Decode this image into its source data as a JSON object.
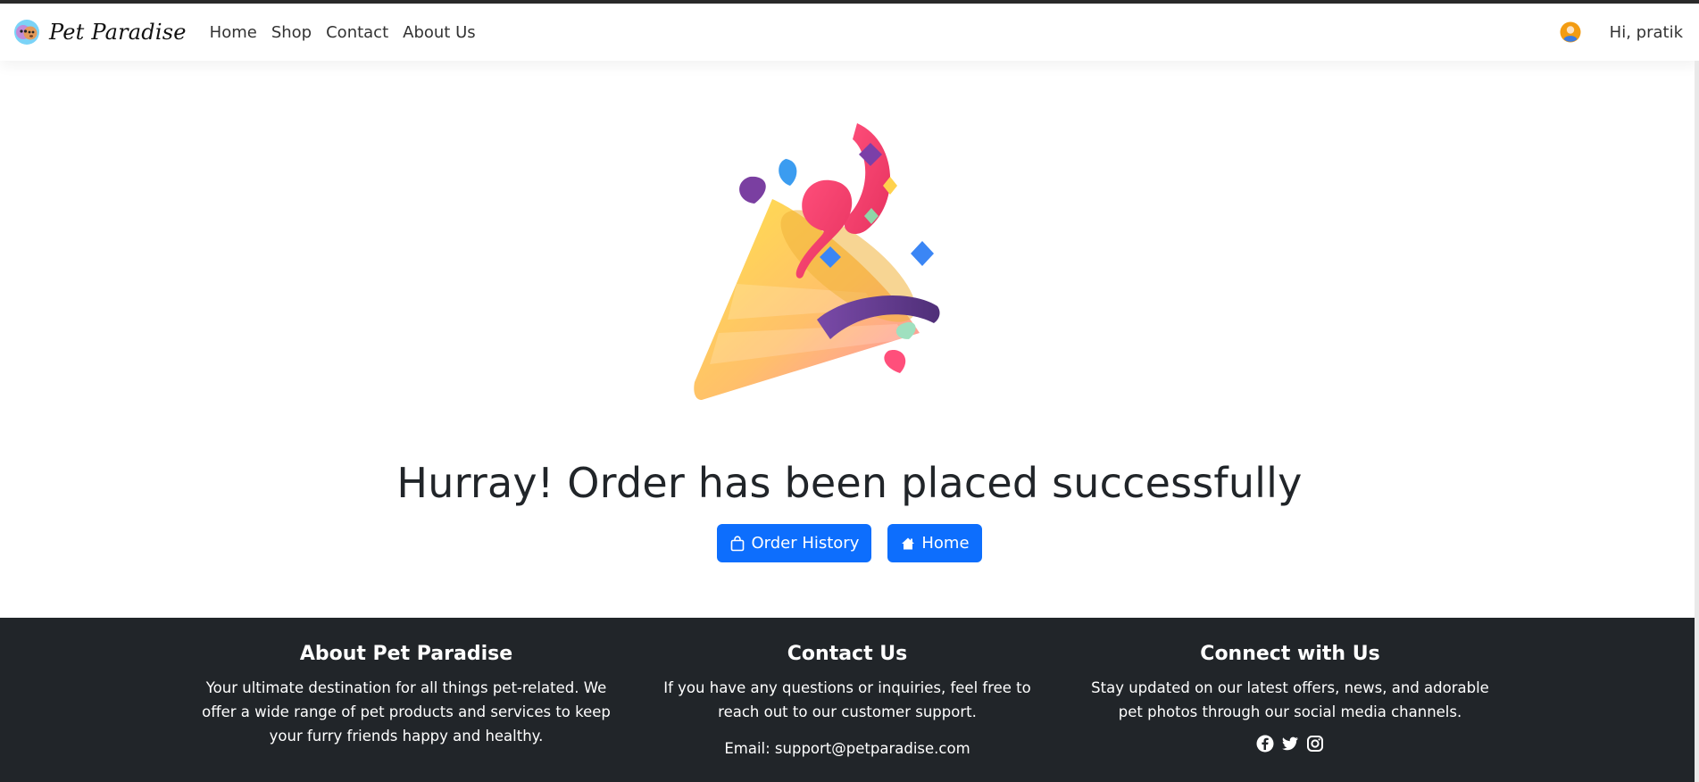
{
  "navbar": {
    "brand": "Pet Paradise",
    "links": [
      "Home",
      "Shop",
      "Contact",
      "About Us"
    ],
    "greeting": "Hi, pratik"
  },
  "main": {
    "illustration": "party-popper-icon",
    "headline": "Hurray! Order has been placed successfully",
    "buttons": [
      {
        "label": "Order History",
        "icon": "shopping-bag-icon"
      },
      {
        "label": "Home",
        "icon": "house-icon"
      }
    ]
  },
  "footer": {
    "about": {
      "title": "About Pet Paradise",
      "text": "Your ultimate destination for all things pet-related. We offer a wide range of pet products and services to keep your furry friends happy and healthy."
    },
    "contact": {
      "title": "Contact Us",
      "text": "If you have any questions or inquiries, feel free to reach out to our customer support.",
      "email": "Email: support@petparadise.com"
    },
    "connect": {
      "title": "Connect with Us",
      "text": "Stay updated on our latest offers, news, and adorable pet photos through our social media channels.",
      "social": [
        "facebook-icon",
        "twitter-icon",
        "instagram-icon"
      ]
    }
  },
  "colors": {
    "primary": "#0d6efd",
    "footer_bg": "#212529",
    "text": "#212529"
  }
}
